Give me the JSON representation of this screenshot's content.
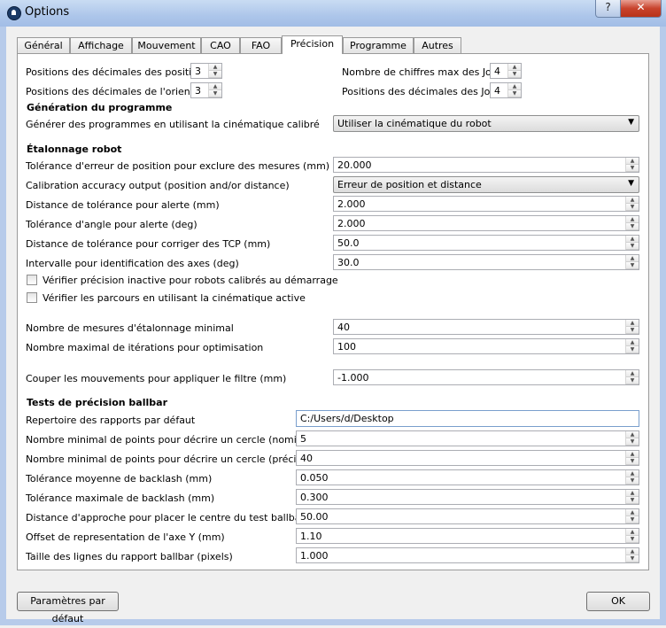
{
  "window": {
    "title": "Options",
    "help_label": "?",
    "close_label": "✕"
  },
  "tabs": [
    "Général",
    "Affichage",
    "Mouvement",
    "CAO",
    "FAO",
    "Précision",
    "Programme",
    "Autres"
  ],
  "top": {
    "dec_positions": {
      "label": "Positions des décimales des positions",
      "value": "3"
    },
    "dec_orientation": {
      "label": "Positions des décimales de l'orientation",
      "value": "3"
    },
    "max_digits_joints": {
      "label": "Nombre de chiffres max des Joints",
      "value": "4"
    },
    "dec_joints": {
      "label": "Positions des décimales des Joints",
      "value": "4"
    }
  },
  "program_gen": {
    "title": "Génération du programme",
    "label": "Générer des programmes en utilisant la cinématique calibré",
    "value": "Utiliser la cinématique du robot"
  },
  "calibration": {
    "title": "Étalonnage robot",
    "rows": [
      {
        "label": "Tolérance d'erreur de position pour exclure des mesures (mm)",
        "value": "20.000"
      },
      {
        "label": "Calibration accuracy output (position and/or distance)",
        "value": "Erreur de position et distance"
      },
      {
        "label": "Distance de tolérance pour alerte (mm)",
        "value": "2.000"
      },
      {
        "label": "Tolérance d'angle pour alerte (deg)",
        "value": "2.000"
      },
      {
        "label": "Distance de tolérance pour corriger des TCP (mm)",
        "value": "50.0"
      },
      {
        "label": "Intervalle pour identification des axes (deg)",
        "value": "30.0"
      }
    ],
    "checkbox1": "Vérifier précision inactive pour robots calibrés au démarrage",
    "checkbox2": "Vérifier les parcours en utilisant la cinématique active",
    "min_measures": {
      "label": "Nombre de mesures d'étalonnage minimal",
      "value": "40"
    },
    "max_iterations": {
      "label": "Nombre maximal de itérations pour optimisation",
      "value": "100"
    },
    "filter": {
      "label": "Couper les mouvements pour appliquer le filtre (mm)",
      "value": "-1.000"
    }
  },
  "ballbar": {
    "title": "Tests de précision ballbar",
    "reports_dir": {
      "label": "Repertoire des rapports par défaut",
      "value": "C:/Users/d/Desktop"
    },
    "rows": [
      {
        "label": "Nombre minimal de points pour décrire un cercle (nominal)",
        "value": "5"
      },
      {
        "label": "Nombre minimal de points pour décrire un cercle (précis)",
        "value": "40"
      },
      {
        "label": "Tolérance moyenne de backlash (mm)",
        "value": "0.050"
      },
      {
        "label": "Tolérance maximale de backlash (mm)",
        "value": "0.300"
      },
      {
        "label": "Distance d'approche pour placer le centre du test ballbar (mm)",
        "value": "50.00"
      },
      {
        "label": "Offset de representation de l'axe Y (mm)",
        "value": "1.10"
      },
      {
        "label": "Taille des lignes du rapport ballbar (pixels)",
        "value": "1.000"
      }
    ]
  },
  "buttons": {
    "defaults": "Paramètres par défaut",
    "ok": "OK"
  }
}
